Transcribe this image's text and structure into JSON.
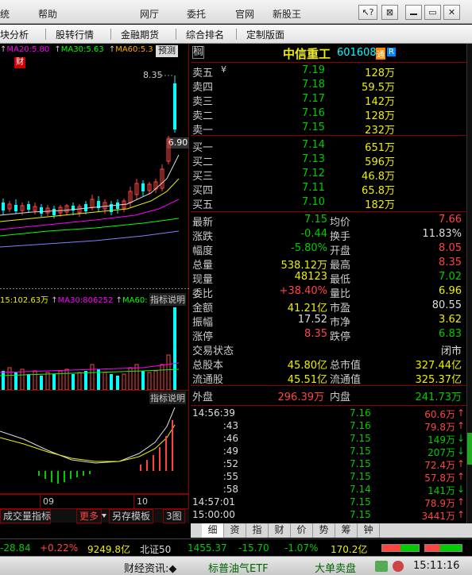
{
  "menubar": {
    "items": [
      "统",
      "帮助",
      "网厅",
      "委托",
      "官网",
      "新股王"
    ],
    "win_buttons": [
      "↖?",
      "⊠",
      "▭",
      "✕"
    ]
  },
  "toolbar": {
    "items": [
      "块分析",
      "股转行情",
      "金融期货",
      "综合排名",
      "定制版面"
    ]
  },
  "chart": {
    "ma_line": {
      "ma20": "MA20:5.80",
      "ma30": "MA30:5.63",
      "ma60": "MA60:5.3"
    },
    "predict_btn": "预测",
    "cai_badge": "财",
    "price_high": "8.35",
    "price_last": "6.90",
    "vol_line": {
      "v1": "15:102.63万",
      "ma30": "MA30:806252",
      "ma60": "MA60:"
    },
    "indicator_btn1": "指标说明",
    "indicator_btn2": "指标说明",
    "month_labels": [
      "09",
      "10"
    ],
    "tabs": [
      "成交量指标",
      "更多",
      "另存模板",
      "3图"
    ]
  },
  "quote": {
    "name": "中信重工",
    "code": "601608",
    "badge_tong": "通",
    "badge_r": "R",
    "corner_icon": "榈",
    "asks": [
      {
        "label": "卖五",
        "price": "7.19",
        "vol": "128万"
      },
      {
        "label": "卖四",
        "price": "7.18",
        "vol": "59.5万"
      },
      {
        "label": "卖三",
        "price": "7.17",
        "vol": "142万"
      },
      {
        "label": "卖二",
        "price": "7.16",
        "vol": "128万"
      },
      {
        "label": "卖一",
        "price": "7.15",
        "vol": "232万"
      }
    ],
    "ask_mark": "¥",
    "bids": [
      {
        "label": "买一",
        "price": "7.14",
        "vol": "651万"
      },
      {
        "label": "买二",
        "price": "7.13",
        "vol": "596万"
      },
      {
        "label": "买三",
        "price": "7.12",
        "vol": "46.8万"
      },
      {
        "label": "买四",
        "price": "7.11",
        "vol": "65.8万"
      },
      {
        "label": "买五",
        "price": "7.10",
        "vol": "182万"
      }
    ],
    "stats": [
      {
        "l1": "最新",
        "v1": "7.15",
        "c1": "grn",
        "l2": "均价",
        "v2": "7.66",
        "c2": "red"
      },
      {
        "l1": "涨跌",
        "v1": "-0.44",
        "c1": "grn",
        "l2": "换手",
        "v2": "11.83%",
        "c2": "wht"
      },
      {
        "l1": "幅度",
        "v1": "-5.80%",
        "c1": "grn",
        "l2": "开盘",
        "v2": "8.05",
        "c2": "red"
      },
      {
        "l1": "总量",
        "v1": "538.12万",
        "c1": "yel",
        "l2": "最高",
        "v2": "8.35",
        "c2": "red"
      },
      {
        "l1": "现量",
        "v1": "48123",
        "c1": "yel",
        "l2": "最低",
        "v2": "7.02",
        "c2": "grn"
      },
      {
        "l1": "委比",
        "v1": "+38.40%",
        "c1": "red",
        "l2": "量比",
        "v2": "6.96",
        "c2": "yel"
      },
      {
        "l1": "金额",
        "v1": "41.21亿",
        "c1": "yel",
        "l2": "市盈",
        "v2": "80.55",
        "c2": "wht"
      },
      {
        "l1": "振幅",
        "v1": "17.52",
        "c1": "wht",
        "l2": "市净",
        "v2": "3.62",
        "c2": "yel"
      },
      {
        "l1": "涨停",
        "v1": "8.35",
        "c1": "red",
        "l2": "跌停",
        "v2": "6.83",
        "c2": "grn"
      }
    ],
    "status_label": "交易状态",
    "status_value": "闭市",
    "capital": [
      {
        "l1": "总股本",
        "v1": "45.80亿",
        "l2": "总市值",
        "v2": "327.44亿"
      },
      {
        "l1": "流通股",
        "v1": "45.51亿",
        "l2": "流通值",
        "v2": "325.37亿"
      }
    ],
    "outer_label": "外盘",
    "outer_value": "296.39万",
    "inner_label": "内盘",
    "inner_value": "241.73万",
    "ticks": [
      {
        "t": "14:56:39",
        "p": "7.16",
        "v": "60.6万",
        "a": "↑",
        "c": "red"
      },
      {
        "t": ":43",
        "p": "7.16",
        "v": "79.8万",
        "a": "↑",
        "c": "red"
      },
      {
        "t": ":46",
        "p": "7.15",
        "v": "149万",
        "a": "↓",
        "c": "grn"
      },
      {
        "t": ":49",
        "p": "7.15",
        "v": "207万",
        "a": "↓",
        "c": "grn"
      },
      {
        "t": ":52",
        "p": "7.15",
        "v": "72.4万",
        "a": "↑",
        "c": "red"
      },
      {
        "t": ":55",
        "p": "7.15",
        "v": "57.8万",
        "a": "↑",
        "c": "red"
      },
      {
        "t": ":58",
        "p": "7.14",
        "v": "141万",
        "a": "↓",
        "c": "grn"
      },
      {
        "t": "14:57:01",
        "p": "7.15",
        "v": "78.9万",
        "a": "↑",
        "c": "red"
      },
      {
        "t": "15:00:00",
        "p": "7.15",
        "v": "3441万",
        "a": "↑",
        "c": "red"
      }
    ]
  },
  "bottom_tabs": [
    "细",
    "资",
    "指",
    "财",
    "价",
    "势",
    "筹",
    "钟"
  ],
  "indexbar": {
    "v1": "-28.84",
    "v2": "+0.22%",
    "v3": "9249.8亿",
    "name": "北证50",
    "v4": "1455.37",
    "v5": "-15.70",
    "v6": "-1.07%",
    "v7": "170.2亿"
  },
  "statusbar": {
    "news_label": "财经资讯:◆",
    "etf": "标普油气ETF",
    "bigorder": "大单卖盘",
    "clock": "15:11:16"
  },
  "colors": {
    "up": "#ff4444",
    "down": "#00cc00",
    "vol": "#ffff00",
    "grid": "#880000"
  }
}
